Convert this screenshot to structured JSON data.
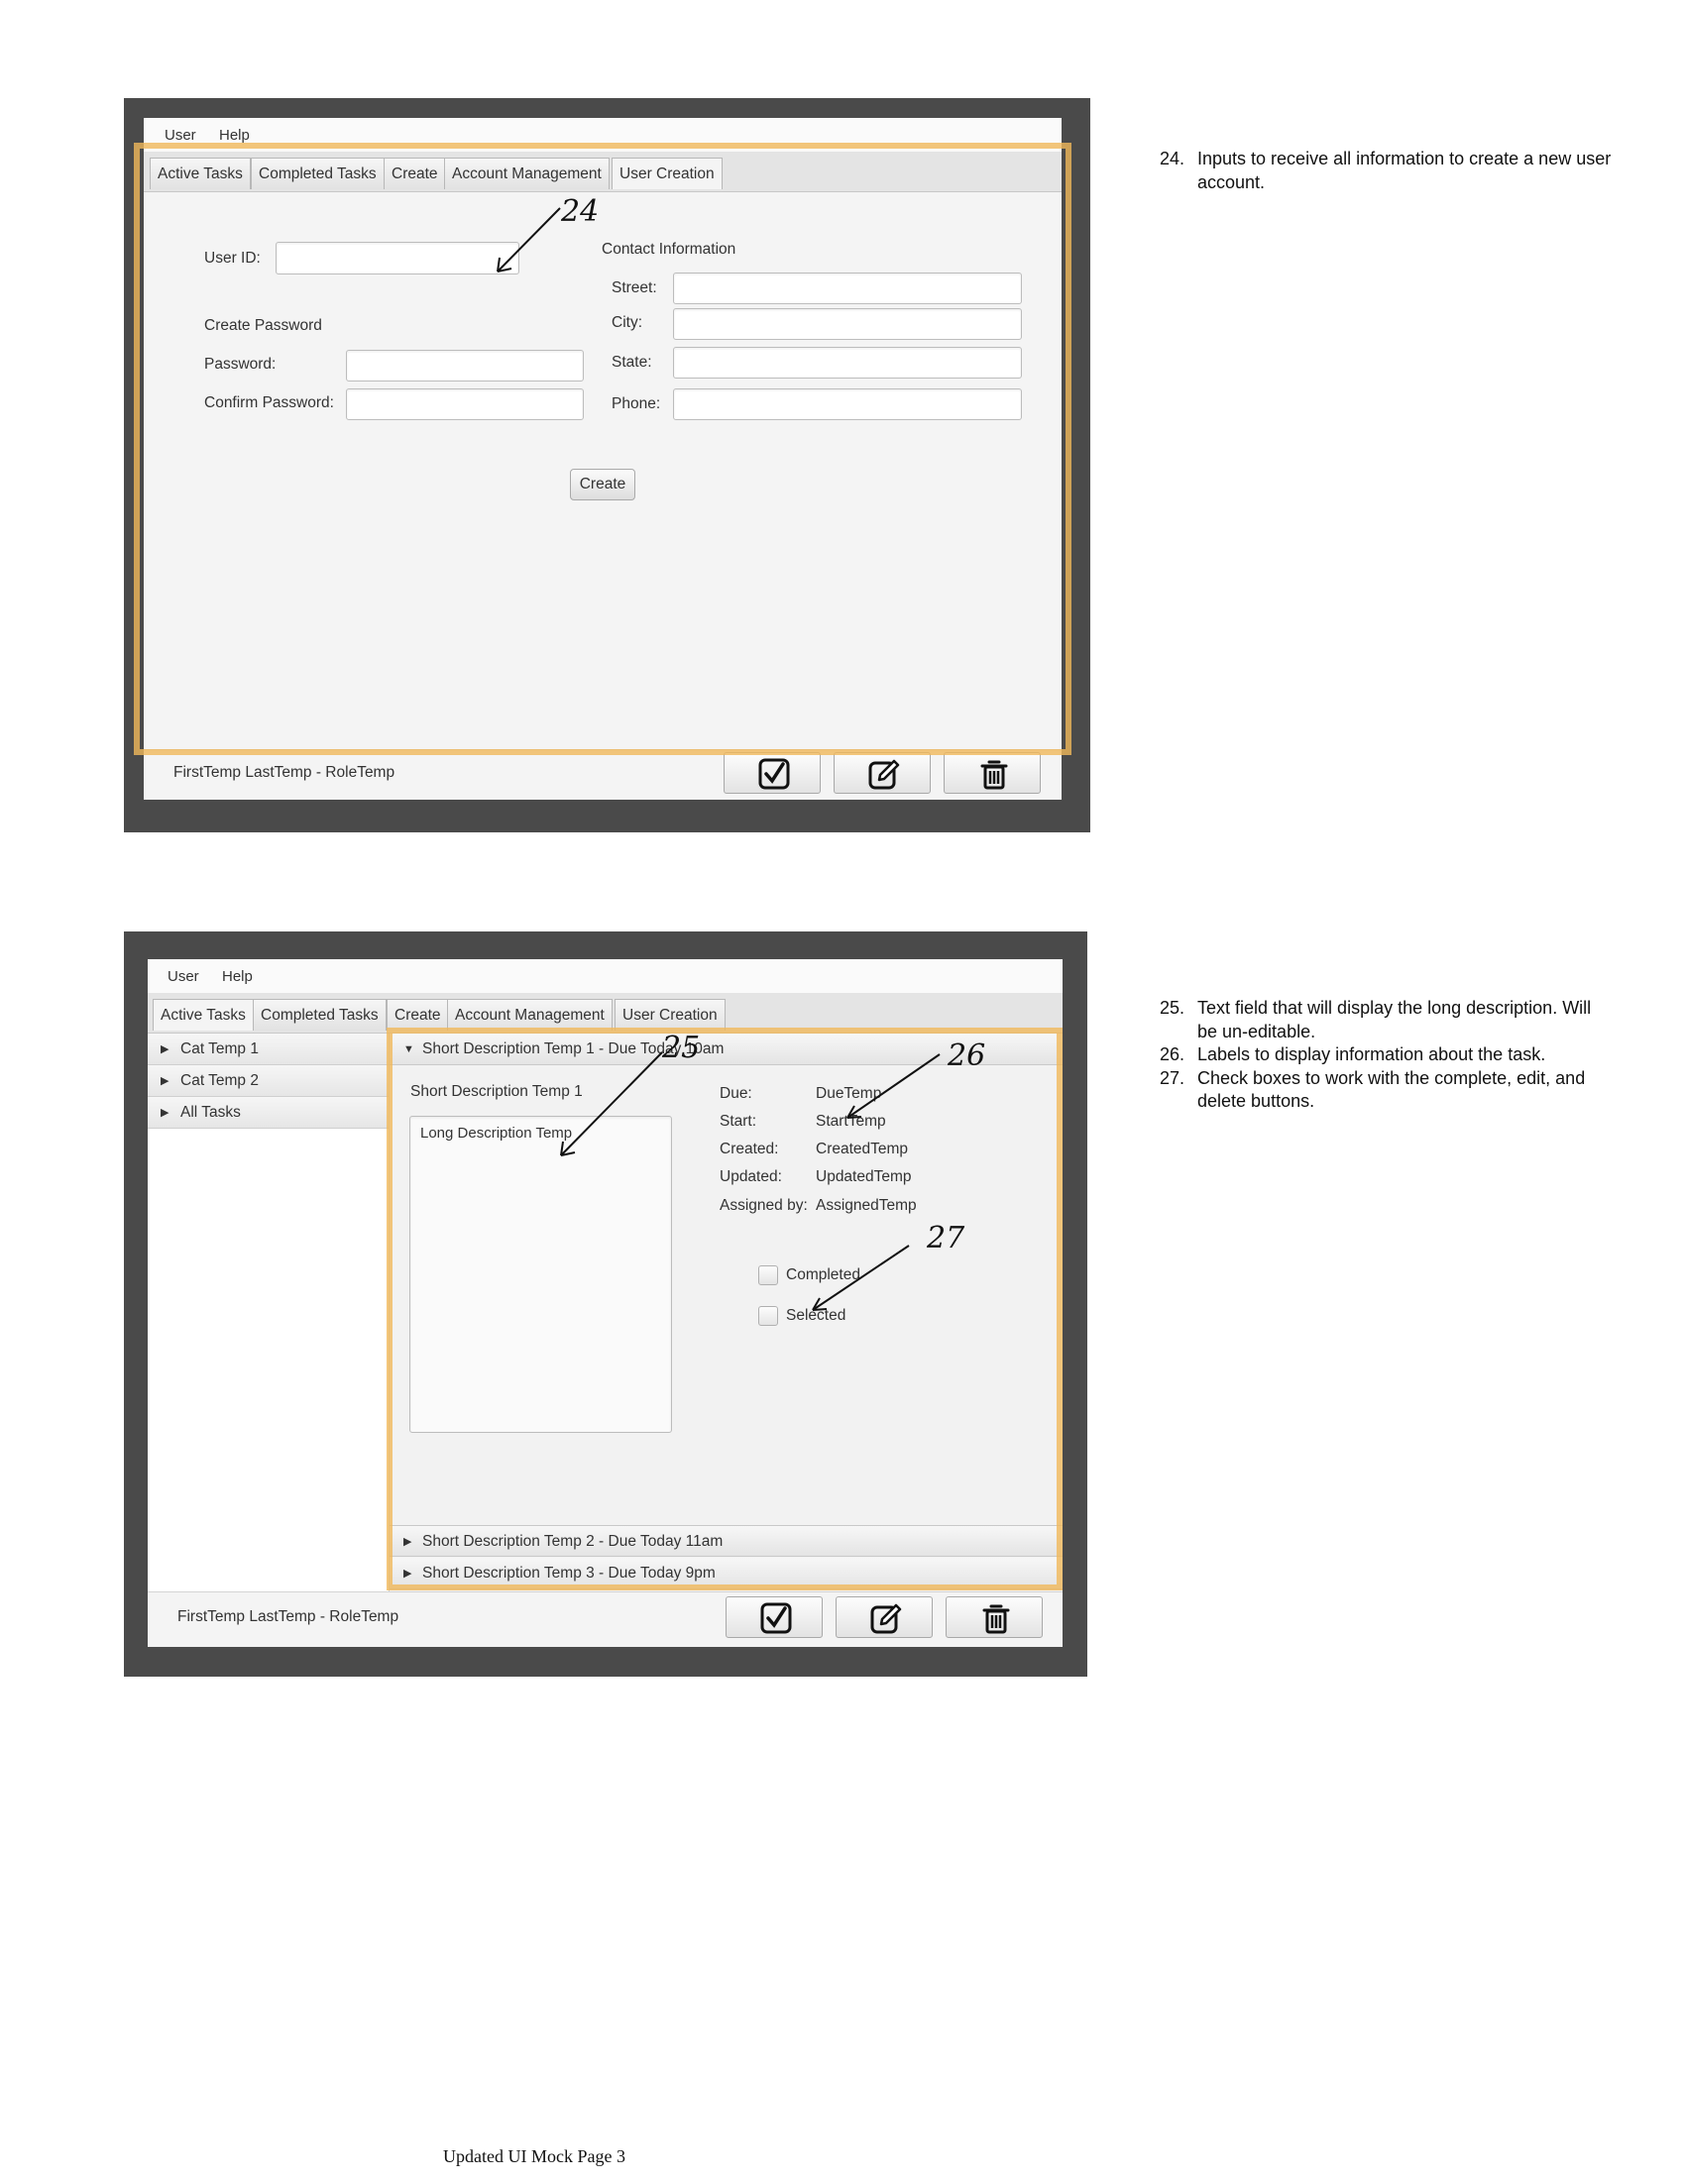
{
  "screen1": {
    "menu": [
      "User",
      "Help"
    ],
    "tabs": [
      "Active Tasks",
      "Completed Tasks",
      "Create",
      "Account Management",
      "User Creation"
    ],
    "form": {
      "user_id_label": "User ID:",
      "user_id_value": "",
      "create_password_heading": "Create Password",
      "password_label": "Password:",
      "password_value": "",
      "confirm_password_label": "Confirm Password:",
      "confirm_password_value": "",
      "contact_heading": "Contact Information",
      "street_label": "Street:",
      "street_value": "",
      "city_label": "City:",
      "city_value": "",
      "state_label": "State:",
      "state_value": "",
      "phone_label": "Phone:",
      "phone_value": "",
      "create_button": "Create"
    },
    "status_text": "FirstTemp LastTemp - RoleTemp",
    "annotation": "24"
  },
  "screen2": {
    "menu": [
      "User",
      "Help"
    ],
    "tabs": [
      "Active Tasks",
      "Completed Tasks",
      "Create",
      "Account Management",
      "User Creation"
    ],
    "tree": [
      "Cat Temp 1",
      "Cat Temp 2",
      "All Tasks"
    ],
    "accordion": [
      "Short Description Temp 1 - Due Today 10am",
      "Short Description Temp 2 - Due Today 11am",
      "Short Description Temp 3 - Due Today 9pm"
    ],
    "detail": {
      "short_description": "Short Description Temp 1",
      "long_description": "Long Description Temp",
      "info": [
        {
          "label": "Due:",
          "value": "DueTemp"
        },
        {
          "label": "Start:",
          "value": "StartTemp"
        },
        {
          "label": "Created:",
          "value": "CreatedTemp"
        },
        {
          "label": "Updated:",
          "value": "UpdatedTemp"
        },
        {
          "label": "Assigned by:",
          "value": "AssignedTemp"
        }
      ],
      "checkbox_completed": "Completed",
      "checkbox_selected": "Selected"
    },
    "status_text": "FirstTemp LastTemp - RoleTemp",
    "annotations": [
      "25",
      "26",
      "27"
    ]
  },
  "notes1": [
    {
      "num": "24.",
      "text": "Inputs to receive all information to create a new user account."
    }
  ],
  "notes2": [
    {
      "num": "25.",
      "text": "Text field that will display the long description. Will be un-editable."
    },
    {
      "num": "26.",
      "text": "Labels to display information about the task."
    },
    {
      "num": "27.",
      "text": "Check boxes to work with the complete, edit, and delete buttons."
    }
  ],
  "footer": "Updated UI Mock Page 3",
  "icons": [
    "check-icon",
    "edit-icon",
    "trash-icon"
  ],
  "colors": {
    "highlight": "#f0b85a",
    "frame": "#4a4a4a"
  }
}
